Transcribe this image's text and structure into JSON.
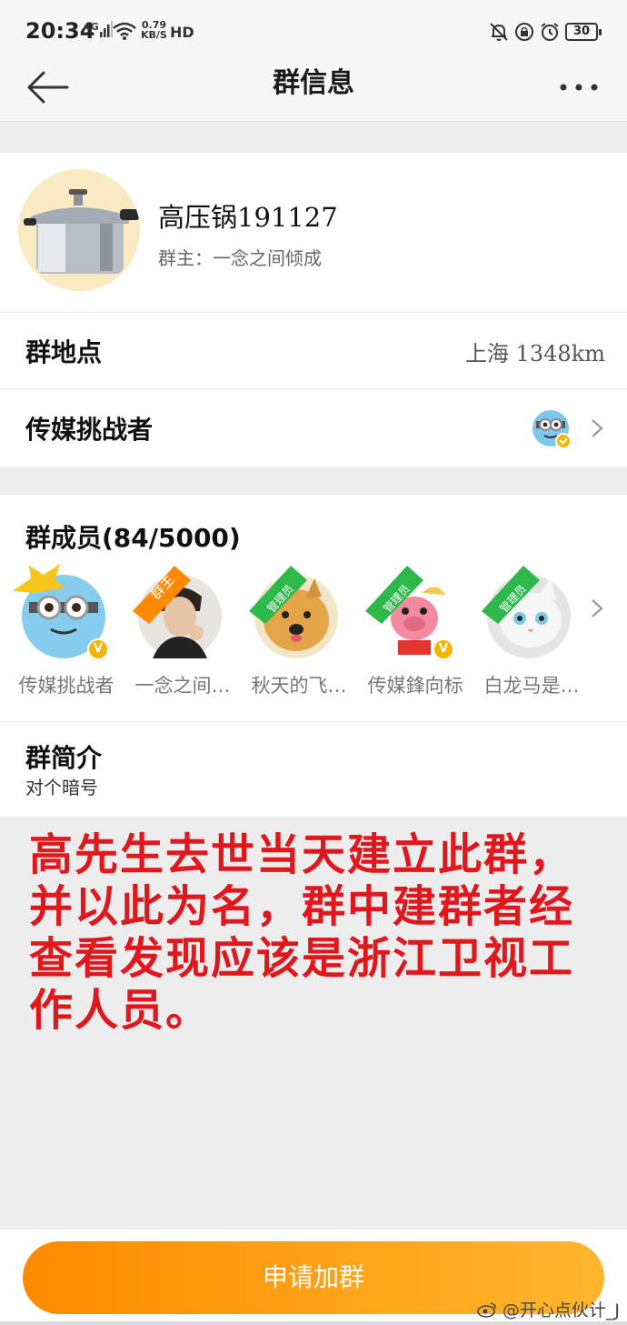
{
  "status_bar": {
    "time": "20:34",
    "network": "4G",
    "speed_value": "0.79",
    "speed_unit": "KB/S",
    "hd": "HD",
    "battery": "30"
  },
  "nav": {
    "title": "群信息"
  },
  "group": {
    "name": "高压锅191127",
    "owner": "群主：一念之间倾成"
  },
  "location": {
    "label": "群地点",
    "value": "上海 1348km"
  },
  "category": {
    "label": "传媒挑战者"
  },
  "members": {
    "title": "群成员(84/5000)",
    "list": [
      {
        "name": "传媒挑战者",
        "badge": "",
        "verified": true
      },
      {
        "name": "一念之间…",
        "badge": "群主",
        "verified": false
      },
      {
        "name": "秋天的飞…",
        "badge": "管理员",
        "verified": false
      },
      {
        "name": "传媒鋒向标",
        "badge": "管理员",
        "verified": true
      },
      {
        "name": "白龙马是…",
        "badge": "管理员",
        "verified": false
      }
    ]
  },
  "intro": {
    "title": "群简介",
    "text": "对个暗号"
  },
  "annotation": "高先生去世当天建立此群，并以此为名，群中建群者经查看发现应该是浙江卫视工作人员。",
  "join_button": "申请加群",
  "watermark": "@开心点伙计_J",
  "colors": {
    "accent_orange": "#ff8a00",
    "annotation_red": "#e0171c",
    "verify_gold": "#f5b400",
    "admin_green": "#2db84c"
  }
}
